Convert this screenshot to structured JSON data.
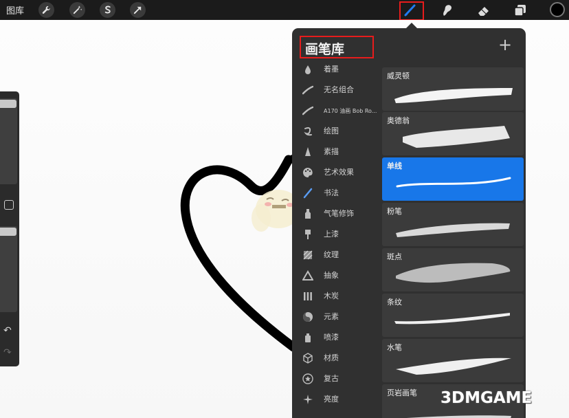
{
  "topbar": {
    "gallery_label": "图库",
    "tools_left": [
      "wrench-icon",
      "magic-wand-icon",
      "selection-icon",
      "transform-arrow-icon"
    ],
    "tools_right": [
      "brush-icon",
      "smudge-icon",
      "eraser-icon",
      "layers-icon"
    ],
    "active_tool": "brush",
    "color": "#000000"
  },
  "panel": {
    "title": "画笔库",
    "add_label": "+",
    "categories": [
      {
        "label": "着墨",
        "icon": "ink-drop-icon"
      },
      {
        "label": "无名组合",
        "icon": "stroke-icon"
      },
      {
        "label": "A170 油画 Bob Ro...",
        "icon": "stroke-icon"
      },
      {
        "label": "绘图",
        "icon": "squiggle-icon"
      },
      {
        "label": "素描",
        "icon": "pencil-tip-icon"
      },
      {
        "label": "艺术效果",
        "icon": "palette-icon"
      },
      {
        "label": "书法",
        "icon": "calligraphy-pen-icon"
      },
      {
        "label": "气笔修饰",
        "icon": "airbrush-icon"
      },
      {
        "label": "上漆",
        "icon": "paint-brush-icon"
      },
      {
        "label": "纹理",
        "icon": "texture-icon"
      },
      {
        "label": "抽象",
        "icon": "triangle-icon"
      },
      {
        "label": "木炭",
        "icon": "charcoal-icon"
      },
      {
        "label": "元素",
        "icon": "yin-yang-icon"
      },
      {
        "label": "喷漆",
        "icon": "spray-can-icon"
      },
      {
        "label": "材质",
        "icon": "cube-icon"
      },
      {
        "label": "复古",
        "icon": "star-badge-icon"
      },
      {
        "label": "亮度",
        "icon": "sparkle-icon"
      }
    ],
    "brushes": [
      {
        "name": "威灵顿",
        "selected": false
      },
      {
        "name": "奥德翁",
        "selected": false
      },
      {
        "name": "单线",
        "selected": true
      },
      {
        "name": "粉笔",
        "selected": false
      },
      {
        "name": "斑点",
        "selected": false
      },
      {
        "name": "条纹",
        "selected": false
      },
      {
        "name": "水笔",
        "selected": false
      },
      {
        "name": "页岩画笔",
        "selected": false
      }
    ]
  },
  "highlight_color": "#e81c1c",
  "selection_color": "#1877e9",
  "watermark": "3DMGAME"
}
